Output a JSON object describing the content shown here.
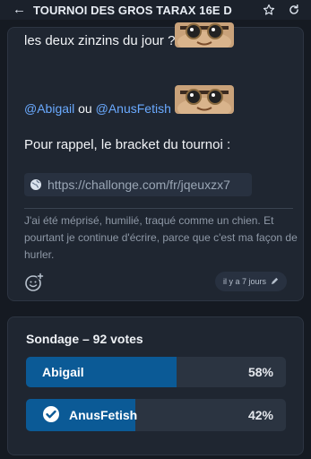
{
  "header": {
    "title": "TOURNOI DES GROS TARAX 16E D",
    "back_icon": "arrow-left-icon",
    "star_icon": "star-icon",
    "refresh_icon": "refresh-icon"
  },
  "post": {
    "line1": "les deux zinzins du jour ?",
    "mention1": "@Abigail",
    "connector": "ou",
    "mention2": "@AnusFetish",
    "question_mark": "?",
    "line3": "Pour rappel, le bracket du tournoi :",
    "link_url": "https://challonge.com/fr/jqeuxzx7",
    "signature": "J'ai été méprisé, humilié, traqué comme un chien. Et pourtant je continue d'écrire, parce que c'est ma façon de hurler.",
    "timestamp": "il y a 7 jours",
    "emote_icon": "sloth-glasses-emote",
    "add_reaction_icon": "add-reaction-icon",
    "edit_icon": "pencil-icon"
  },
  "poll": {
    "title": "Sondage – 92 votes",
    "options": [
      {
        "label": "Abigail",
        "percent_text": "58%",
        "fraction": 0.58,
        "voted": false
      },
      {
        "label": "AnusFetish",
        "percent_text": "42%",
        "fraction": 0.42,
        "voted": true
      }
    ]
  },
  "colors": {
    "background": "#151a22",
    "card": "#1f2631",
    "mention": "#6aaaff",
    "poll_fill": "#0b5a96"
  }
}
